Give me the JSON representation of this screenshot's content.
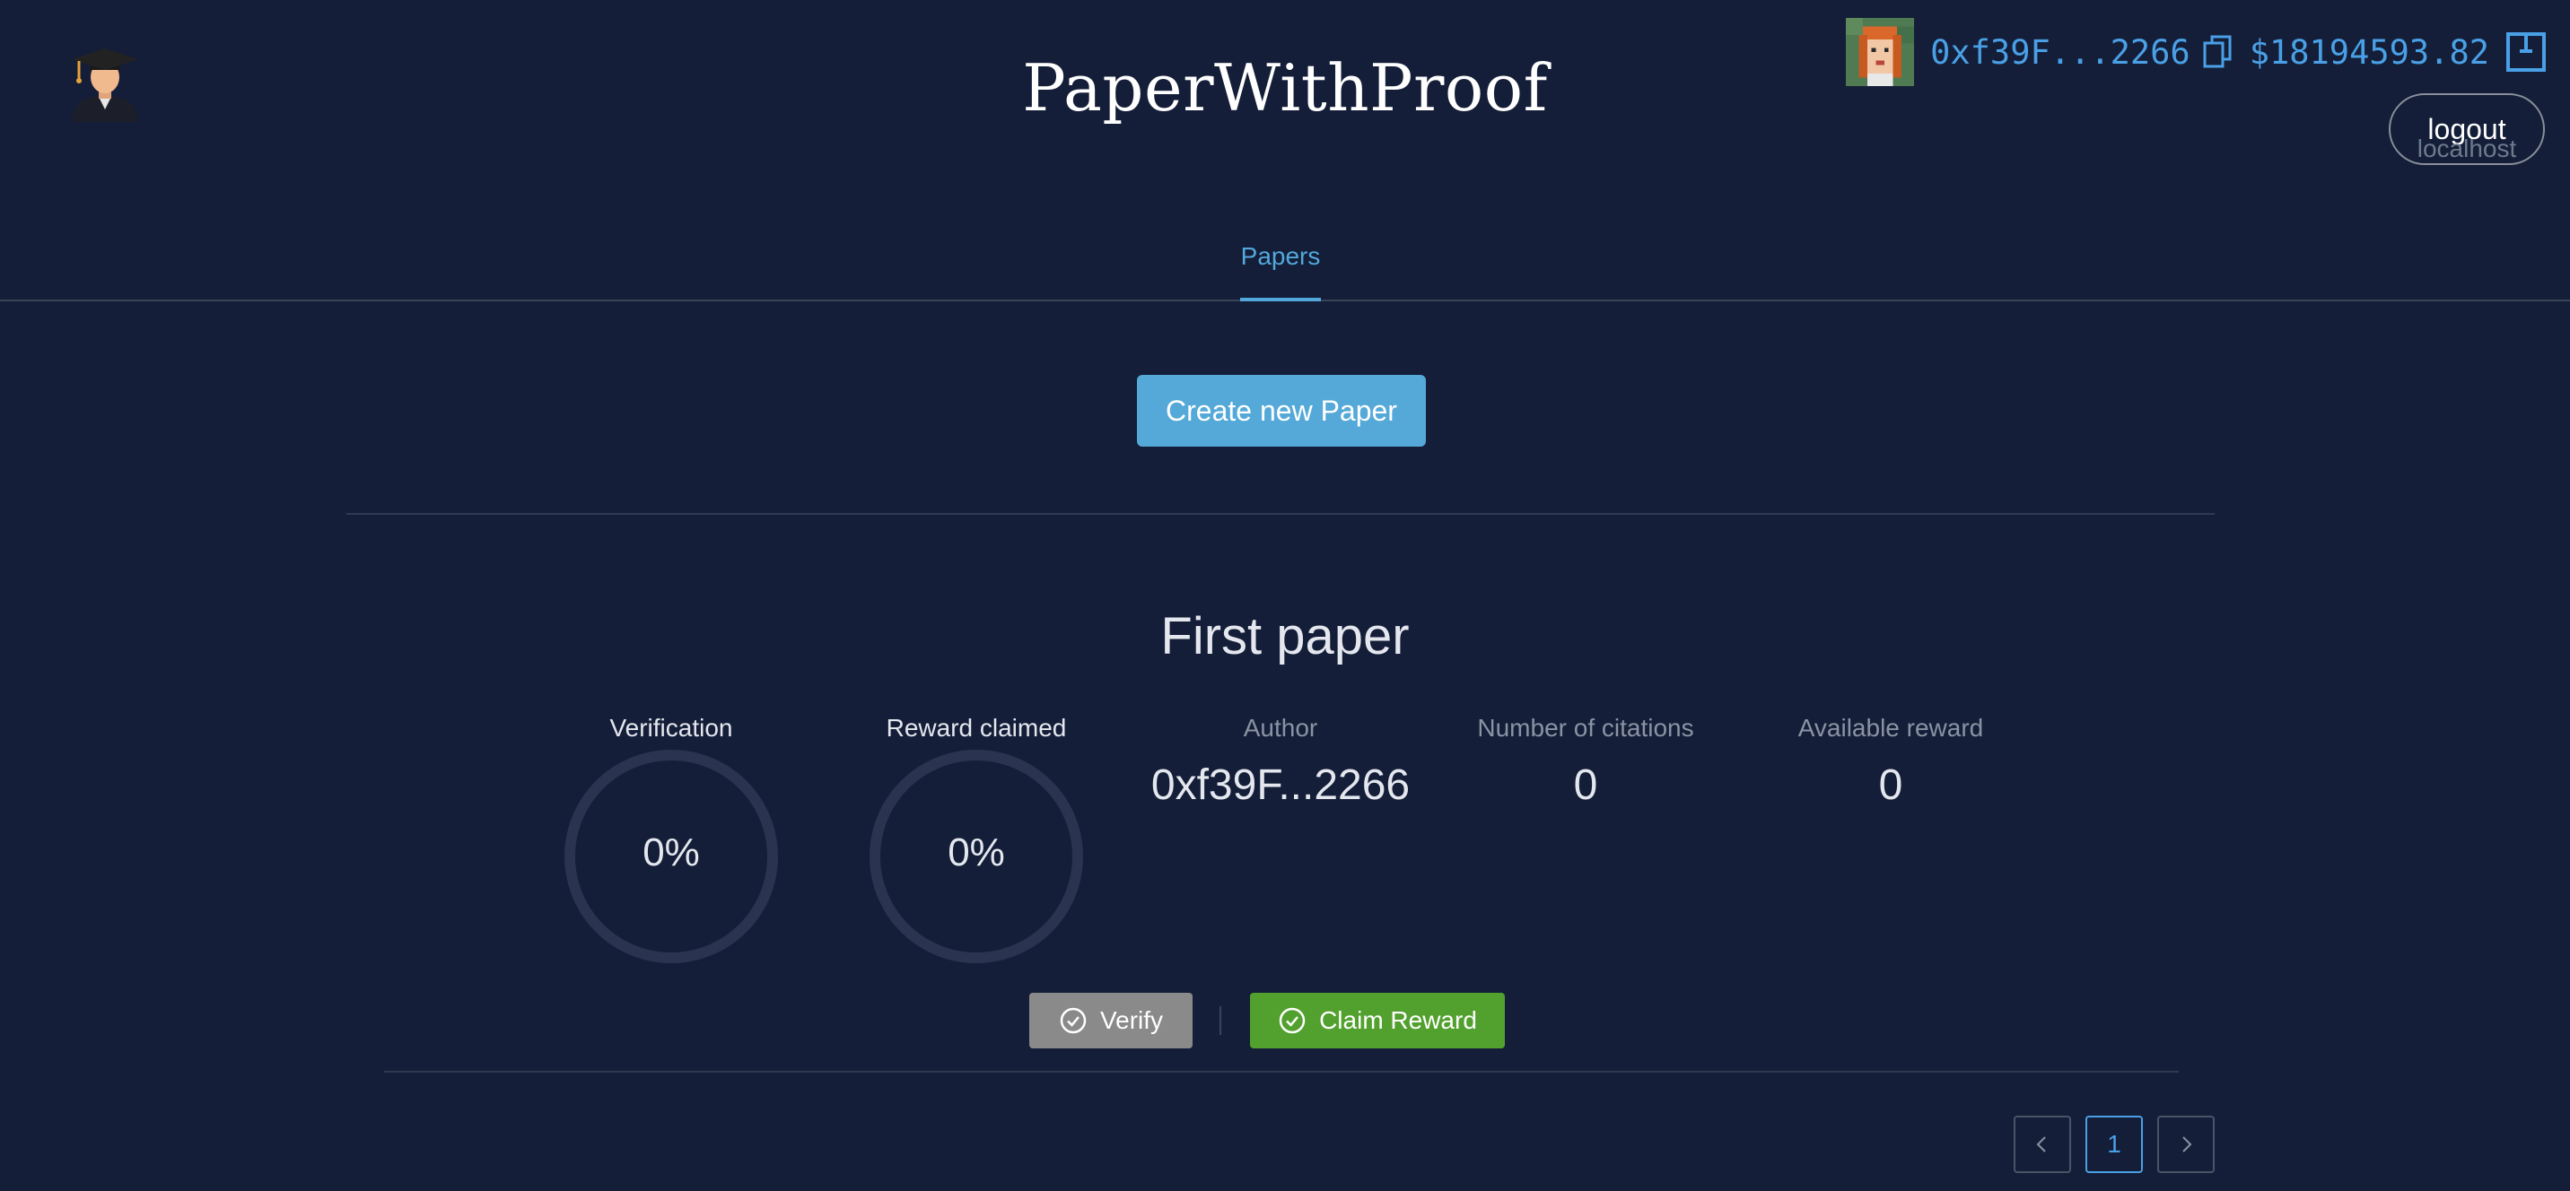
{
  "header": {
    "site_title": "PaperWithProof",
    "logo_icon": "graduate-avatar-icon"
  },
  "account": {
    "address_short": "0xf39F...2266",
    "balance": "$18194593.82",
    "logout_label": "logout",
    "network_label": "localhost",
    "avatar_icon": "pixel-avatar-icon"
  },
  "tabs": [
    {
      "label": "Papers",
      "active": true
    }
  ],
  "actions": {
    "create_label": "Create new Paper"
  },
  "paper": {
    "title": "First paper",
    "verification_label": "Verification",
    "verification_value": "0%",
    "verification_fraction": 0,
    "reward_claimed_label": "Reward claimed",
    "reward_claimed_value": "0%",
    "reward_claimed_fraction": 0,
    "author_label": "Author",
    "author_value": "0xf39F...2266",
    "citations_label": "Number of citations",
    "citations_value": "0",
    "reward_label": "Available reward",
    "reward_value": "0",
    "verify_label": "Verify",
    "claim_label": "Claim Reward"
  },
  "pagination": {
    "current_page": "1"
  },
  "colors": {
    "background": "#141e38",
    "accent": "#54a9d8",
    "claim_green": "#52a02e",
    "verify_gray": "#8a8a8a",
    "ring_track": "#2a3450"
  }
}
